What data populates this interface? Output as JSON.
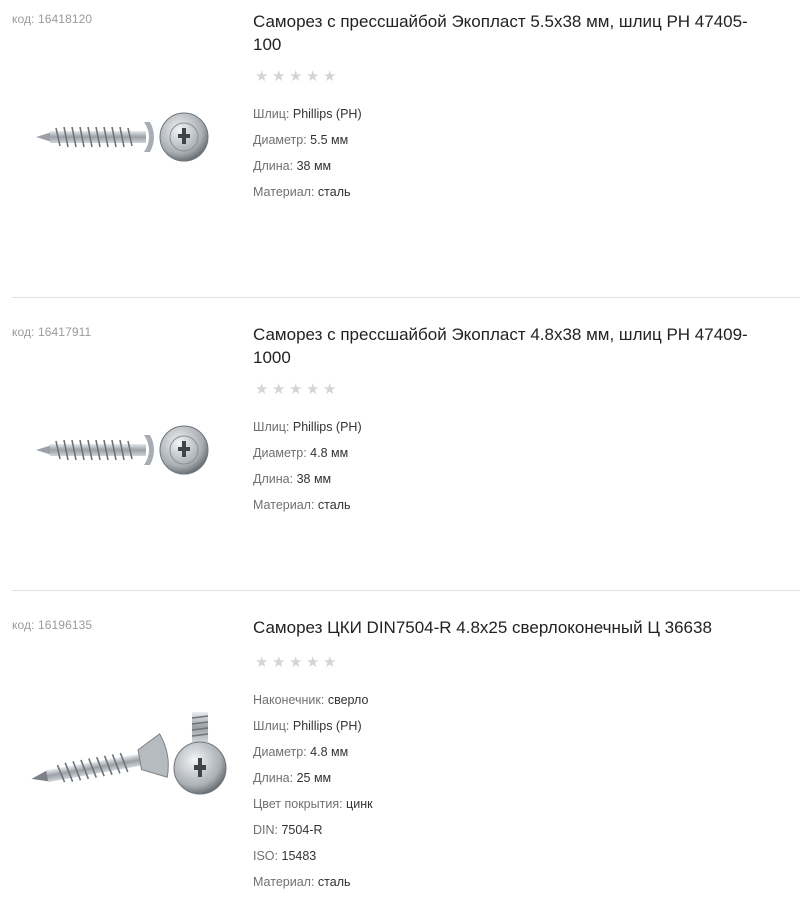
{
  "products": [
    {
      "code_label": "код:",
      "code": "16418120",
      "title": "Саморез с прессшайбой Экопласт 5.5x38 мм, шлиц PH 47405-100",
      "rating_stars": 5,
      "rating_value": 0,
      "specs": [
        {
          "key": "Шлиц:",
          "value": "Phillips (PH)"
        },
        {
          "key": "Диаметр:",
          "value": "5.5 мм"
        },
        {
          "key": "Длина:",
          "value": "38 мм"
        },
        {
          "key": "Материал:",
          "value": "сталь"
        }
      ]
    },
    {
      "code_label": "код:",
      "code": "16417911",
      "title": "Саморез с прессшайбой Экопласт 4.8x38 мм, шлиц PH 47409-1000",
      "rating_stars": 5,
      "rating_value": 0,
      "specs": [
        {
          "key": "Шлиц:",
          "value": "Phillips (PH)"
        },
        {
          "key": "Диаметр:",
          "value": "4.8 мм"
        },
        {
          "key": "Длина:",
          "value": "38 мм"
        },
        {
          "key": "Материал:",
          "value": "сталь"
        }
      ]
    },
    {
      "code_label": "код:",
      "code": "16196135",
      "title": "Саморез ЦКИ DIN7504-R 4.8x25 сверлоконечный Ц 36638",
      "rating_stars": 5,
      "rating_value": 0,
      "specs": [
        {
          "key": "Наконечник:",
          "value": "сверло"
        },
        {
          "key": "Шлиц:",
          "value": "Phillips (PH)"
        },
        {
          "key": "Диаметр:",
          "value": "4.8 мм"
        },
        {
          "key": "Длина:",
          "value": "25 мм"
        },
        {
          "key": "Цвет покрытия:",
          "value": "цинк"
        },
        {
          "key": "DIN:",
          "value": "7504-R"
        },
        {
          "key": "ISO:",
          "value": "15483"
        },
        {
          "key": "Материал:",
          "value": "сталь"
        }
      ]
    }
  ],
  "icons": {
    "star": "star-icon",
    "product_image": "screw-image"
  },
  "colors": {
    "star_empty": "#d4d4d4",
    "divider": "#e3e3e3",
    "code_text": "#9a9a9a"
  }
}
